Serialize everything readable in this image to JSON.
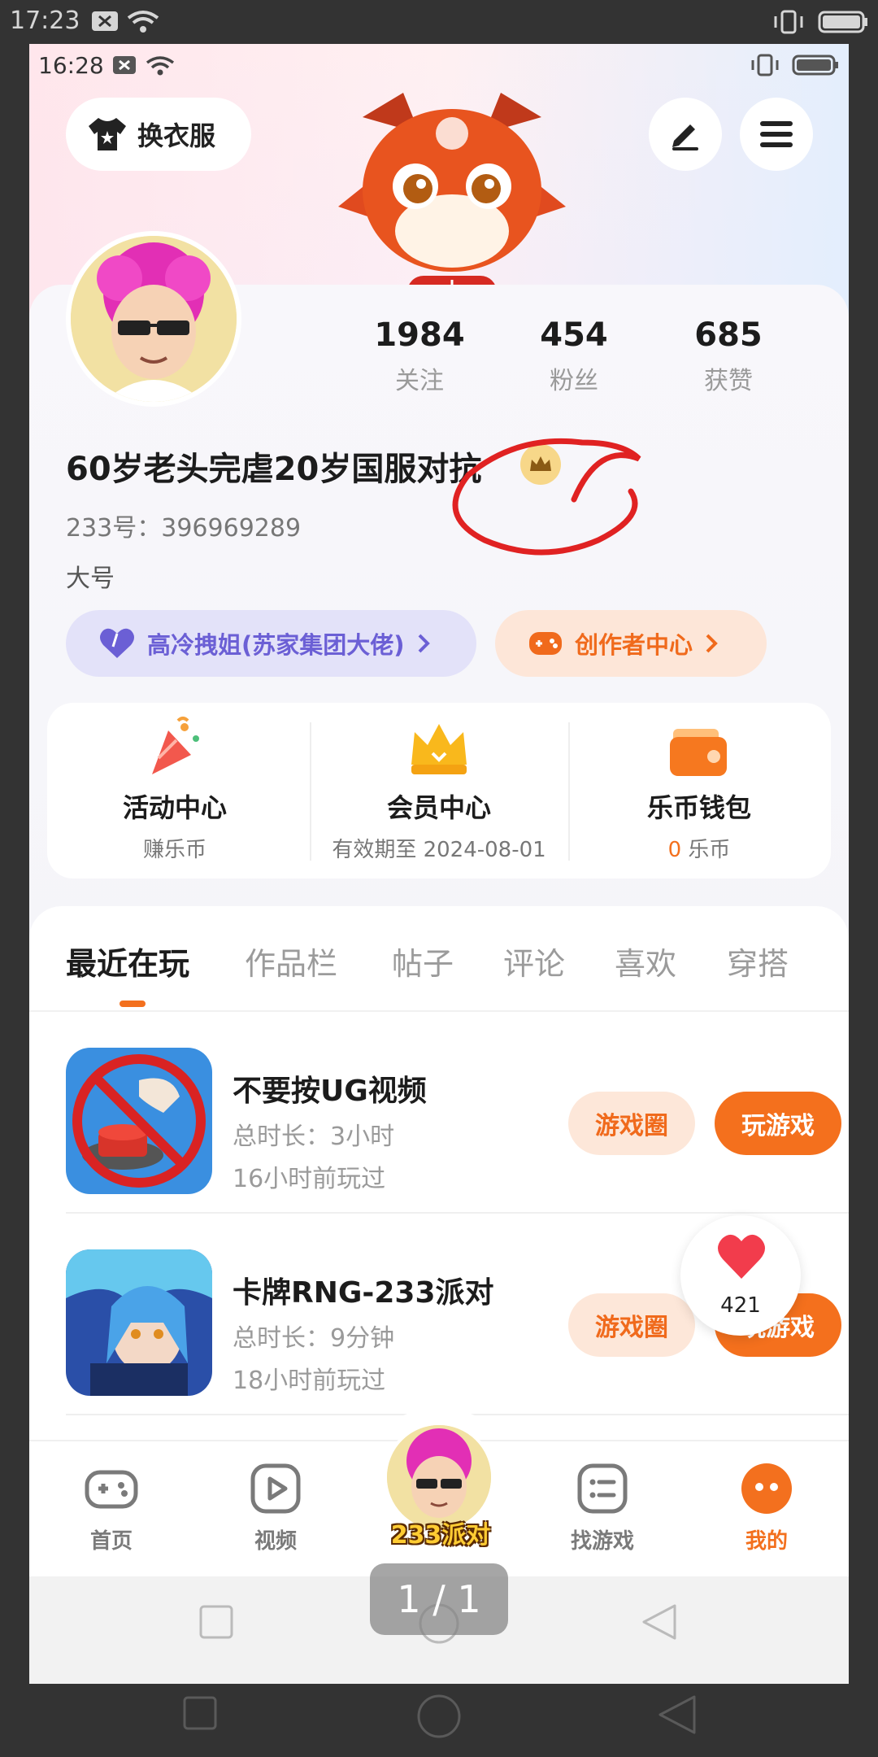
{
  "outer_status": {
    "time": "17:23"
  },
  "inner_status": {
    "time": "16:28"
  },
  "header": {
    "outfit_label": "换衣服"
  },
  "stats": [
    {
      "value": "1984",
      "label": "关注"
    },
    {
      "value": "454",
      "label": "粉丝"
    },
    {
      "value": "685",
      "label": "获赞"
    }
  ],
  "profile": {
    "nickname": "60岁老头完虐20岁国服对抗",
    "uid": "233号：396969289",
    "signature": "大号"
  },
  "tags": {
    "relation": "高冷拽姐(苏家集团大佬)",
    "creator": "创作者中心"
  },
  "centers": [
    {
      "title": "活动中心",
      "sub": "赚乐币"
    },
    {
      "title": "会员中心",
      "sub": "有效期至 2024-08-01"
    },
    {
      "title": "乐币钱包",
      "sub_value": "0",
      "sub_unit": "乐币"
    }
  ],
  "tabs": [
    "最近在玩",
    "作品栏",
    "帖子",
    "评论",
    "喜欢",
    "穿搭"
  ],
  "games": [
    {
      "title": "不要按UG视频",
      "duration": "总时长：3小时",
      "last_played": "16小时前玩过",
      "circle_label": "游戏圈",
      "play_label": "玩游戏"
    },
    {
      "title": "卡牌RNG-233派对",
      "duration": "总时长：9分钟",
      "last_played": "18小时前玩过",
      "circle_label": "游戏圈",
      "play_label": "玩游戏"
    }
  ],
  "like_float": {
    "count": "421"
  },
  "bottom_nav": [
    {
      "label": "首页"
    },
    {
      "label": "视频"
    },
    {
      "label": "找游戏"
    },
    {
      "label": "我的"
    }
  ],
  "center_logo": "233派对",
  "page_indicator": "1 / 1",
  "colors": {
    "accent": "#f3701e",
    "purple": "#6b5fd5"
  }
}
